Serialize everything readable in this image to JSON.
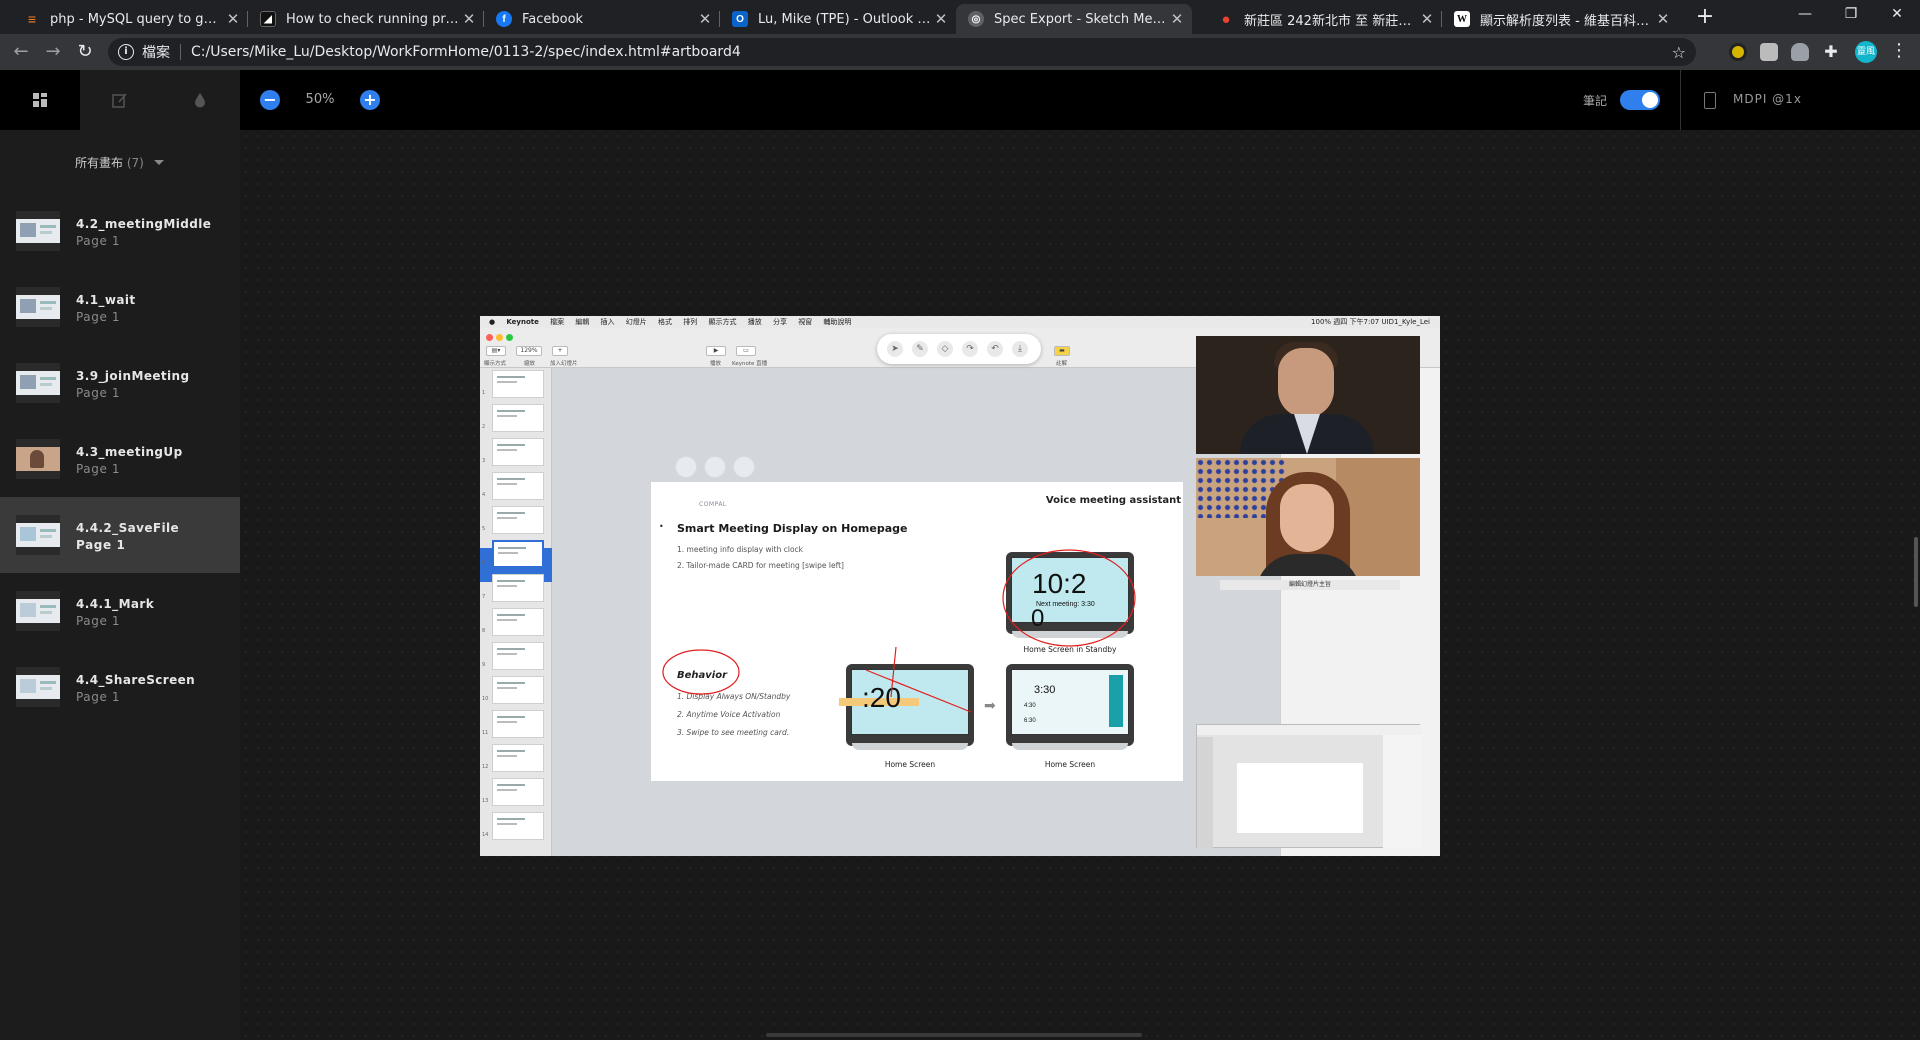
{
  "browser": {
    "tabs": [
      {
        "title": "php - MySQL query to get colu",
        "icon": "stackoverflow-icon",
        "color": "#f48024"
      },
      {
        "title": "How to check running process",
        "icon": "dev-icon",
        "color": "#111111"
      },
      {
        "title": "Facebook",
        "icon": "facebook-icon",
        "color": "#1877f2"
      },
      {
        "title": "Lu, Mike (TPE) - Outlook Web A",
        "icon": "outlook-icon",
        "color": "#0a64c9"
      },
      {
        "title": "Spec Export - Sketch Measure 2",
        "icon": "globe-icon",
        "color": "#9aa0a6"
      },
      {
        "title": "新莊區 242新北市 至 新莊區 242",
        "icon": "maps-icon",
        "color": "#34a853"
      },
      {
        "title": "顯示解析度列表 - 維基百科，自由",
        "icon": "wikipedia-icon",
        "color": "#ffffff"
      }
    ],
    "active_tab_index": 4,
    "scheme_label": "檔案",
    "url": "C:/Users/Mike_Lu/Desktop/WorkFormHome/0113-2/spec/index.html#artboard4",
    "profile_initials": "靈風"
  },
  "app": {
    "zoom_level": "50%",
    "notes_label": "筆記",
    "notes_enabled": true,
    "resolution": "MDPI @1x"
  },
  "sidebar": {
    "header_label": "所有畫布",
    "header_count": "(7)",
    "artboards": [
      {
        "name": "4.2_meetingMiddle",
        "page": "Page 1",
        "selected": false
      },
      {
        "name": "4.1_wait",
        "page": "Page 1",
        "selected": false
      },
      {
        "name": "3.9_joinMeeting",
        "page": "Page 1",
        "selected": false
      },
      {
        "name": "4.3_meetingUp",
        "page": "Page 1",
        "selected": false
      },
      {
        "name": "4.4.2_SaveFile",
        "page": "Page 1",
        "selected": true
      },
      {
        "name": "4.4.1_Mark",
        "page": "Page 1",
        "selected": false
      },
      {
        "name": "4.4_ShareScreen",
        "page": "Page 1",
        "selected": false
      }
    ]
  },
  "artboard": {
    "mac_menu": {
      "app": "Keynote",
      "items": [
        "檔案",
        "編輯",
        "插入",
        "幻燈片",
        "格式",
        "排列",
        "顯示方式",
        "播放",
        "分享",
        "視窗",
        "輔助說明"
      ],
      "status": "100%  週四 下午7:07  UID1_Kyle_Lei"
    },
    "toolbar": {
      "view_label": "顯示方式",
      "zoom_value": "129%",
      "zoom_label": "縮放",
      "add_slide_label": "加入幻燈片",
      "play_label": "播放",
      "keynote_live_label": "Keynote 直播",
      "comment_label": "註解"
    },
    "navigator_numbers": [
      "1",
      "2",
      "3",
      "4",
      "5",
      "6",
      "7",
      "8",
      "9",
      "10",
      "11",
      "12",
      "13",
      "14"
    ],
    "slide": {
      "brand": "COMPAL",
      "title": "Voice meeting assistant",
      "headline": "Smart Meeting Display on Homepage",
      "points": [
        "1. meeting info display with clock",
        "2. Tailor-made CARD for meeting [swipe left]"
      ],
      "behavior_title": "Behavior",
      "behavior_points": [
        "1. Display Always ON/Standby",
        "2. Anytime Voice Activation",
        "3. Swipe to see meeting card."
      ],
      "standby_time": "10:2",
      "standby_next": "Next meeting: 3:30",
      "standby_zero": "0",
      "standby_caption": "Home Screen in Standby",
      "home_time": ":20",
      "home_caption": "Home Screen",
      "card_time": "3:30",
      "card_caption": "Home Screen",
      "card_rows": [
        "4:30",
        "6:30"
      ]
    },
    "video_label": "編輯幻燈片主旨"
  }
}
